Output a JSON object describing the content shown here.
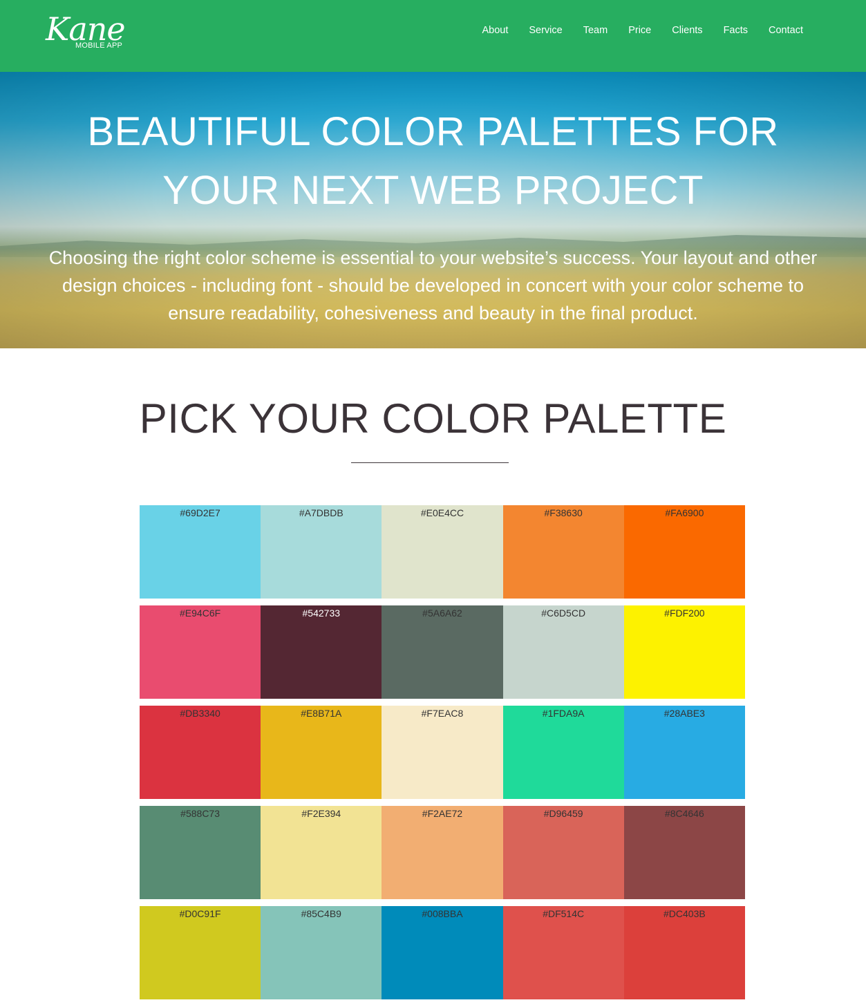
{
  "brand": {
    "name": "Kane",
    "tagline": "MOBILE APP"
  },
  "nav": {
    "items": [
      {
        "label": "About"
      },
      {
        "label": "Service"
      },
      {
        "label": "Team"
      },
      {
        "label": "Price"
      },
      {
        "label": "Clients"
      },
      {
        "label": "Facts"
      },
      {
        "label": "Contact"
      }
    ]
  },
  "hero": {
    "title": "BEAUTIFUL COLOR PALETTES FOR YOUR NEXT WEB PROJECT",
    "description": "Choosing the right color scheme is essential to your website’s success. Your layout and other design choices - including font - should be developed in concert with your color scheme to ensure readability, cohesiveness and beauty in the final product."
  },
  "section": {
    "title": "PICK YOUR COLOR PALETTE"
  },
  "palettes": [
    [
      "#69D2E7",
      "#A7DBDB",
      "#E0E4CC",
      "#F38630",
      "#FA6900"
    ],
    [
      "#E94C6F",
      "#542733",
      "#5A6A62",
      "#C6D5CD",
      "#FDF200"
    ],
    [
      "#DB3340",
      "#E8B71A",
      "#F7EAC8",
      "#1FDA9A",
      "#28ABE3"
    ],
    [
      "#588C73",
      "#F2E394",
      "#F2AE72",
      "#D96459",
      "#8C4646"
    ],
    [
      "#D0C91F",
      "#85C4B9",
      "#008BBA",
      "#DF514C",
      "#DC403B"
    ]
  ],
  "colors": {
    "navbar": "#27ae60",
    "heading": "#3b3338"
  }
}
